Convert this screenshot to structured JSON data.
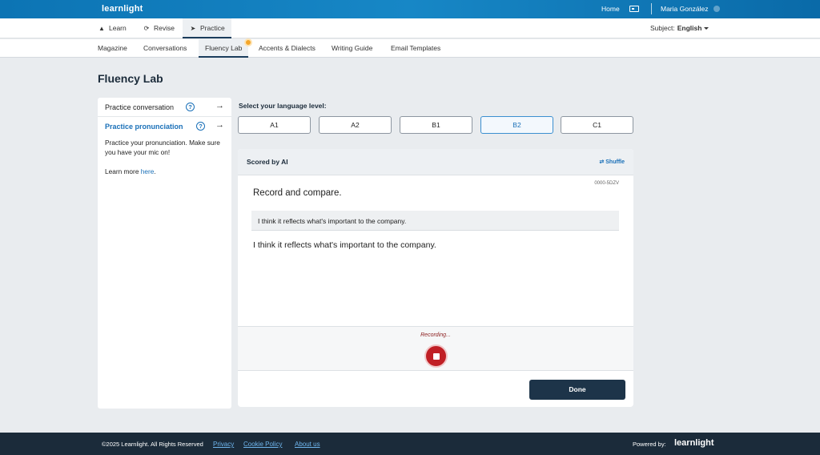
{
  "topbar": {
    "brand": "learnlight",
    "home_label": "Home",
    "user_name": "Maria González"
  },
  "nav": {
    "items": [
      {
        "label": "Learn",
        "icon": "graduation-cap-icon"
      },
      {
        "label": "Revise",
        "icon": "refresh-icon"
      },
      {
        "label": "Practice",
        "icon": "rocket-icon",
        "active": true
      }
    ],
    "subject_label": "Subject:",
    "subject_value": "English"
  },
  "subnav": {
    "items": [
      "Magazine",
      "Conversations",
      "Fluency Lab",
      "Accents & Dialects",
      "Writing Guide",
      "Email Templates"
    ],
    "active": "Fluency Lab"
  },
  "page": {
    "title": "Fluency Lab"
  },
  "left_panel": {
    "items": [
      {
        "label": "Practice conversation",
        "active": false
      },
      {
        "label": "Practice pronunciation",
        "active": true
      }
    ],
    "description": "Practice your pronunciation. Make sure you have your mic on!",
    "learn_more_prefix": "Learn more ",
    "learn_more_link": "here",
    "learn_more_suffix": "."
  },
  "levels": {
    "label": "Select your language level:",
    "options": [
      "A1",
      "A2",
      "B1",
      "B2",
      "C1"
    ],
    "selected": "B2"
  },
  "card": {
    "header_title": "Scored by AI",
    "shuffle_label": "Shuffle",
    "code": "0000-5DZV",
    "instruction": "Record and compare.",
    "sentence_reference": "I think it reflects what's important to the company.",
    "sentence_main": "I think it reflects what's important to the company.",
    "recording_status": "Recording...",
    "done_label": "Done"
  },
  "footer": {
    "copyright": "©2025 Learnlight. All Rights Reserved",
    "links": [
      "Privacy",
      "Cookie Policy",
      "About us"
    ],
    "powered_by": "Powered by:",
    "brand": "learnlight"
  },
  "colors": {
    "topbar": "#1787c6",
    "accent": "#1a70b8",
    "record": "#c01f25",
    "dark": "#1d3449"
  }
}
